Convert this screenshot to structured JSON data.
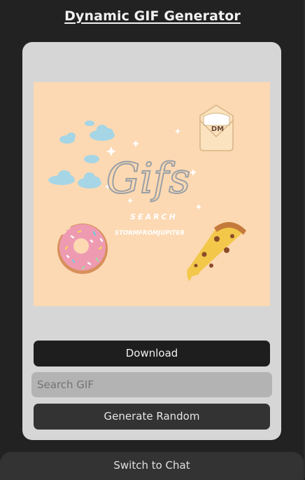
{
  "app": {
    "title": "Dynamic GIF Generator"
  },
  "gif": {
    "logo_text": "Gifs",
    "search_text": "SEARCH",
    "author_text": "STORMFROMJUPITER",
    "envelope_text": "DM",
    "background_color": "#fcd9b3"
  },
  "controls": {
    "download_label": "Download",
    "search_placeholder": "Search GIF",
    "search_value": "",
    "generate_label": "Generate Random"
  },
  "footer": {
    "switch_label": "Switch to Chat"
  },
  "colors": {
    "page_background": "#222222",
    "card_background": "#d6d6d6",
    "download_button": "#1e1e1e",
    "search_field": "#b3b3b3",
    "generate_button": "#333333",
    "footer_bar": "#333333"
  },
  "icons": {
    "clouds": "cloud-icon",
    "envelope": "envelope-icon",
    "donut": "donut-icon",
    "pizza": "pizza-slice-icon",
    "sparkles": "sparkle-icon"
  }
}
